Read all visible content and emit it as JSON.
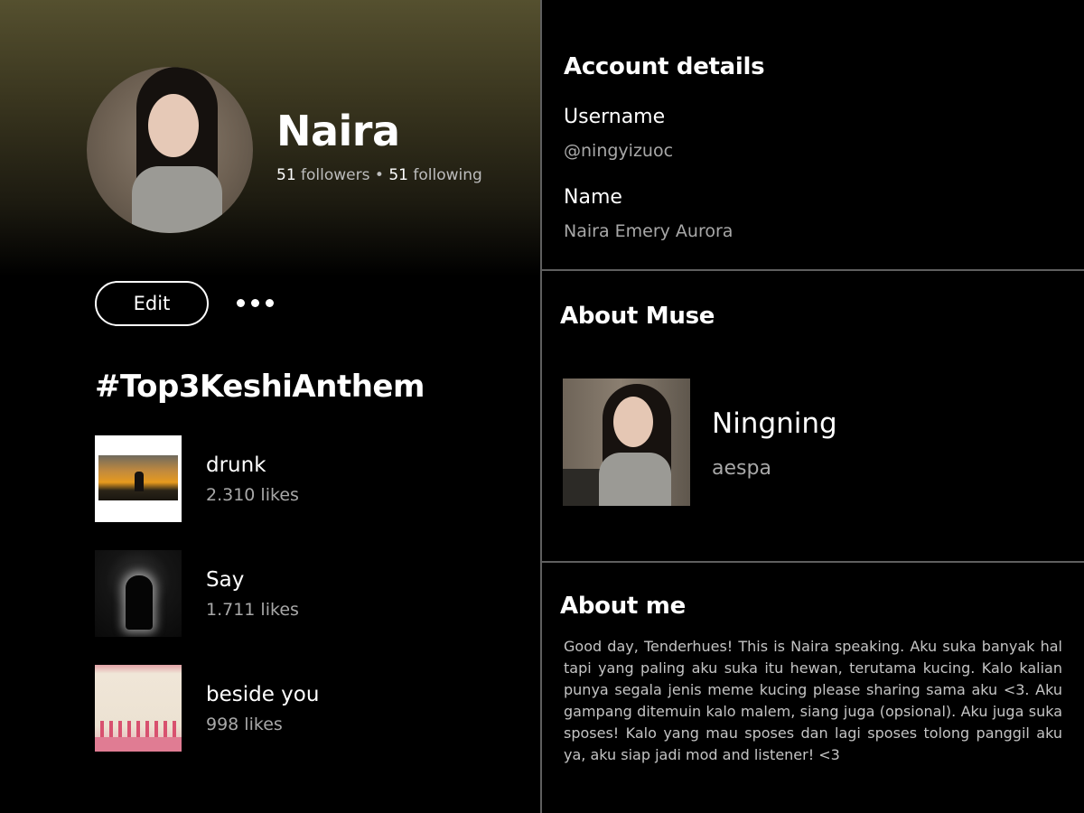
{
  "profile": {
    "name": "Naira",
    "followers_count": "51",
    "followers_label": "followers",
    "separator": "•",
    "following_count": "51",
    "following_label": "following",
    "edit_label": "Edit"
  },
  "playlist": {
    "title": "#Top3KeshiAnthem",
    "tracks": [
      {
        "title": "drunk",
        "likes": "2.310 likes"
      },
      {
        "title": "Say",
        "likes": "1.711 likes"
      },
      {
        "title": "beside you",
        "likes": "998 likes"
      }
    ]
  },
  "account": {
    "heading": "Account details",
    "username_label": "Username",
    "username_value": "@ningyizuoc",
    "name_label": "Name",
    "name_value": "Naira Emery Aurora"
  },
  "muse": {
    "heading": "About Muse",
    "name": "Ningning",
    "group": "aespa"
  },
  "about_me": {
    "heading": "About me",
    "text": "Good day, Tenderhues! This is Naira speaking. Aku suka banyak hal tapi yang paling aku suka itu hewan, terutama kucing. Kalo kalian punya segala jenis meme kucing please sharing sama aku <3. Aku gampang ditemuin kalo malem, siang juga (opsional). Aku juga suka sposes! Kalo yang mau sposes dan lagi sposes tolong panggil aku ya, aku siap jadi mod and listener! <3"
  },
  "icons": {
    "more": "more-horizontal-icon"
  },
  "colors": {
    "background": "#000000",
    "header_gradient": "#55502f",
    "muted_text": "#a8a8a8",
    "divider": "#5f5f5f"
  }
}
